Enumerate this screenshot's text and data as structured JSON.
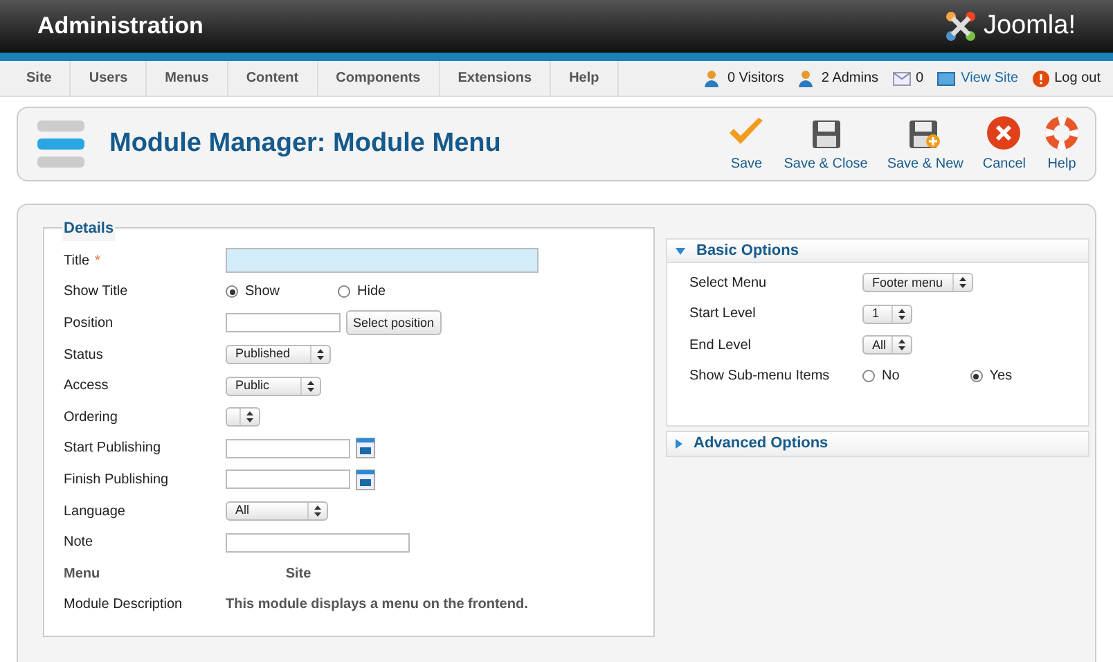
{
  "header": {
    "title": "Administration",
    "logo": "Joomla!"
  },
  "menu": [
    {
      "label": "Site"
    },
    {
      "label": "Users"
    },
    {
      "label": "Menus"
    },
    {
      "label": "Content"
    },
    {
      "label": "Components"
    },
    {
      "label": "Extensions"
    },
    {
      "label": "Help"
    }
  ],
  "status": [
    {
      "kind": "visitors",
      "label": "0 Visitors"
    },
    {
      "kind": "admins",
      "label": "2 Admins"
    },
    {
      "kind": "messages",
      "label": "0"
    },
    {
      "kind": "view_site",
      "label": "View Site"
    },
    {
      "kind": "logout",
      "label": "Log out"
    }
  ],
  "toolbar": {
    "title": "Module Manager: Module Menu",
    "buttons": [
      {
        "kind": "save",
        "label": "Save"
      },
      {
        "kind": "save_close",
        "label": "Save & Close"
      },
      {
        "kind": "save_new",
        "label": "Save & New"
      },
      {
        "kind": "cancel",
        "label": "Cancel"
      },
      {
        "kind": "help",
        "label": "Help"
      }
    ]
  },
  "details": {
    "legend": "Details",
    "fields": [
      {
        "kind": "text",
        "label": "Title",
        "required_mark": "*",
        "focused": true
      },
      {
        "kind": "radio",
        "label": "Show Title",
        "options": [
          {
            "label": "Show",
            "selected": true
          },
          {
            "label": "Hide",
            "selected": false
          }
        ]
      },
      {
        "kind": "text_button",
        "label": "Position",
        "button": "Select position"
      },
      {
        "kind": "select",
        "label": "Status",
        "value": "Published"
      },
      {
        "kind": "select",
        "label": "Access",
        "value": "Public"
      },
      {
        "kind": "select",
        "label": "Ordering"
      },
      {
        "kind": "date",
        "label": "Start Publishing"
      },
      {
        "kind": "date",
        "label": "Finish Publishing"
      },
      {
        "kind": "select",
        "label": "Language",
        "value": "All"
      },
      {
        "kind": "text",
        "label": "Note",
        "focused": false
      },
      {
        "kind": "static_bold",
        "label": "Menu",
        "value": "Site"
      },
      {
        "kind": "static",
        "label": "Module Description",
        "value": "This module displays a menu on the frontend."
      }
    ]
  },
  "options": [
    {
      "title": "Basic Options",
      "expanded": true,
      "fields": [
        {
          "kind": "select",
          "label": "Select Menu",
          "value": "Footer menu"
        },
        {
          "kind": "select",
          "label": "Start Level",
          "value": "1"
        },
        {
          "kind": "select",
          "label": "End Level",
          "value": "All"
        },
        {
          "kind": "radio",
          "label": "Show Sub-menu Items",
          "options": [
            {
              "label": "No",
              "selected": false
            },
            {
              "label": "Yes",
              "selected": true
            }
          ]
        }
      ]
    },
    {
      "title": "Advanced Options",
      "expanded": false
    }
  ]
}
